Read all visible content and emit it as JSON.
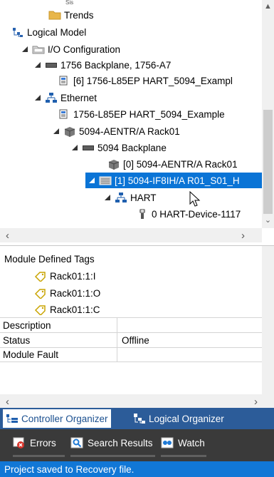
{
  "tree": {
    "rows": [
      {
        "label": "Trends"
      },
      {
        "label": "Logical Model"
      },
      {
        "label": "I/O Configuration"
      },
      {
        "label": "1756 Backplane, 1756-A7"
      },
      {
        "label": "[6] 1756-L85EP HART_5094_Exampl"
      },
      {
        "label": "Ethernet"
      },
      {
        "label": "1756-L85EP HART_5094_Example"
      },
      {
        "label": "5094-AENTR/A Rack01"
      },
      {
        "label": "5094 Backplane"
      },
      {
        "label": "[0] 5094-AENTR/A Rack01"
      },
      {
        "label": "[1] 5094-IF8IH/A R01_S01_H"
      },
      {
        "label": "HART"
      },
      {
        "label": "0 HART-Device-1117"
      }
    ],
    "partial_label": "Sis"
  },
  "properties": {
    "header": "Module Defined Tags",
    "tags": [
      "Rack01:1:I",
      "Rack01:1:O",
      "Rack01:1:C"
    ],
    "grid": [
      {
        "name": "Description",
        "value": ""
      },
      {
        "name": "Status",
        "value": "Offline"
      },
      {
        "name": "Module Fault",
        "value": ""
      }
    ]
  },
  "organizer_tabs": [
    {
      "label": "Controller Organizer",
      "active": true
    },
    {
      "label": "Logical Organizer",
      "active": false
    }
  ],
  "bottom_tabs": [
    {
      "label": "Errors"
    },
    {
      "label": "Search Results"
    },
    {
      "label": "Watch"
    }
  ],
  "status_bar": {
    "text": "Project saved to Recovery file."
  },
  "colors": {
    "selection": "#0a74d6",
    "organizer_bar": "#2c5c99",
    "status_bar": "#1177d6",
    "bottom_bar": "#3a3a3a"
  }
}
